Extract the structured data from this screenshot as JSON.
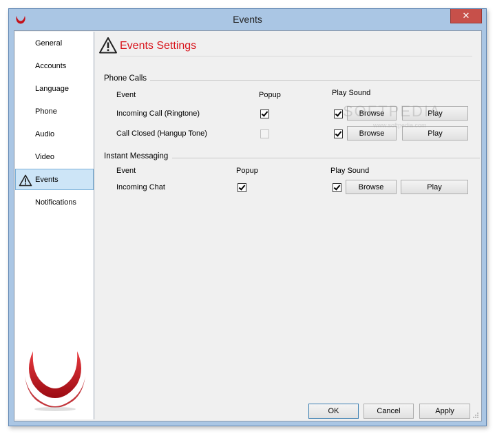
{
  "window": {
    "title": "Events",
    "close_label": "✕"
  },
  "sidebar": {
    "items": [
      {
        "label": "General"
      },
      {
        "label": "Accounts"
      },
      {
        "label": "Language"
      },
      {
        "label": "Phone"
      },
      {
        "label": "Audio"
      },
      {
        "label": "Video"
      },
      {
        "label": "Events",
        "active": true
      },
      {
        "label": "Notifications"
      }
    ]
  },
  "header": {
    "title": "Events Settings",
    "icon": "warning-triangle-icon"
  },
  "phone_calls": {
    "title": "Phone Calls",
    "headers": {
      "event": "Event",
      "popup": "Popup",
      "sound": "Play Sound"
    },
    "rows": [
      {
        "event": "Incoming Call (Ringtone)",
        "popup": true,
        "popup_enabled": true,
        "sound": true,
        "browse": "Browse",
        "play": "Play"
      },
      {
        "event": "Call Closed (Hangup Tone)",
        "popup": false,
        "popup_enabled": false,
        "sound": true,
        "browse": "Browse",
        "play": "Play"
      }
    ]
  },
  "instant_messaging": {
    "title": "Instant Messaging",
    "headers": {
      "event": "Event",
      "popup": "Popup",
      "sound": "Play Sound"
    },
    "rows": [
      {
        "event": "Incoming Chat",
        "popup": true,
        "popup_enabled": true,
        "sound": true,
        "browse": "Browse",
        "play": "Play"
      }
    ]
  },
  "footer": {
    "ok": "OK",
    "cancel": "Cancel",
    "apply": "Apply"
  },
  "watermark": "SOFTPEDIA",
  "watermark_sub": "www.softpedia.com",
  "colors": {
    "accent_red": "#d8141c",
    "selection": "#cde5f7",
    "title_bar": "#aac6e4"
  }
}
